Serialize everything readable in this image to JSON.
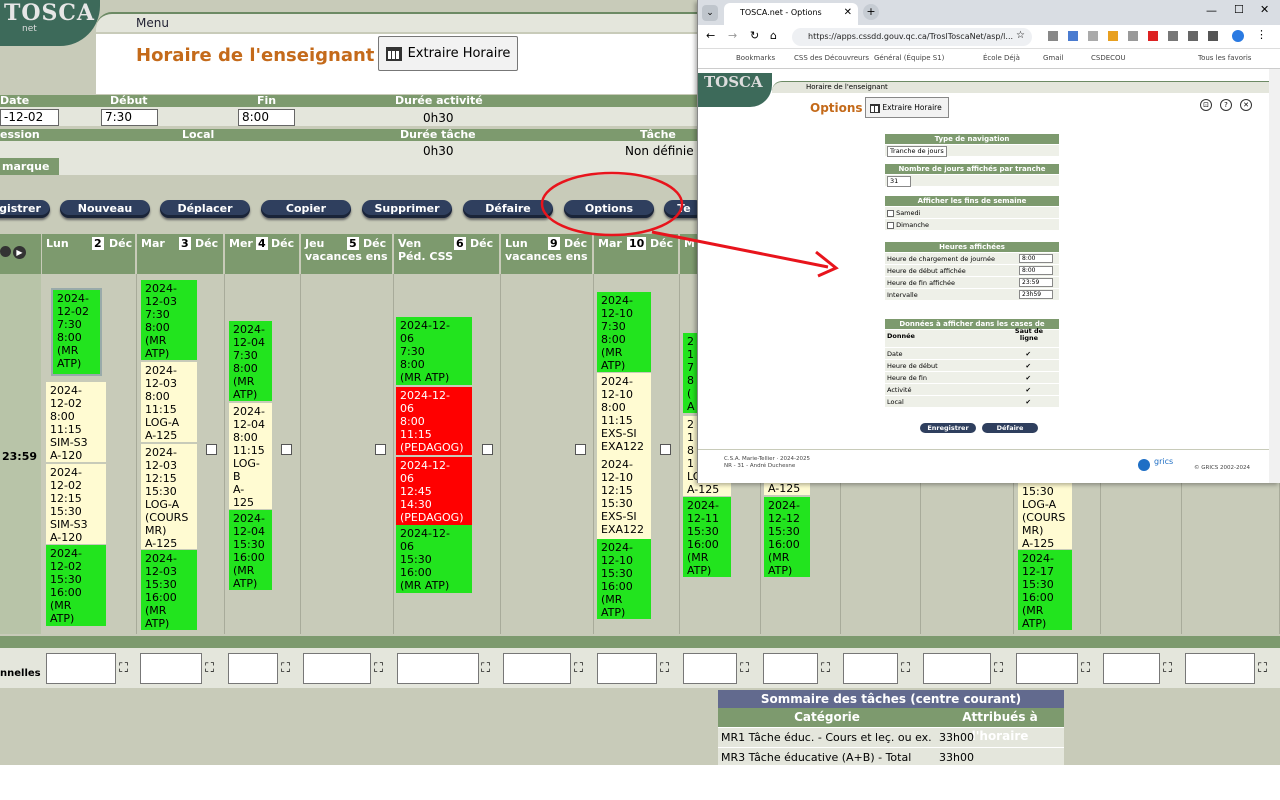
{
  "header": {
    "logo_text": "TOSCA",
    "logo_sub": "net",
    "menu_label": "Menu",
    "page_title": "Horaire de l'enseignant",
    "extract_label": "Extraire Horaire"
  },
  "form": {
    "date_label": "Date",
    "debut_label": "Début",
    "fin_label": "Fin",
    "duree_activite_label": "Durée activité",
    "date_value": "-12-02",
    "debut_value": "7:30",
    "fin_value": "8:00",
    "duree_activite_value": "0h30",
    "session_label": "ession",
    "local_label": "Local",
    "duree_tache_label": "Durée tâche",
    "tache_label": "Tâche",
    "duree_tache_value": "0h30",
    "tache_value": "Non définie",
    "remarque_label": "marque"
  },
  "actions": [
    "gistrer",
    "Nouveau",
    "Déplacer",
    "Copier",
    "Supprimer",
    "Défaire",
    "Options",
    "Te"
  ],
  "days": [
    {
      "name": "Lun",
      "num": "2",
      "month": "Déc",
      "sub": ""
    },
    {
      "name": "Mar",
      "num": "3",
      "month": "Déc",
      "sub": ""
    },
    {
      "name": "Mer",
      "num": "4",
      "month": "Déc",
      "sub": ""
    },
    {
      "name": "Jeu",
      "num": "5",
      "month": "Déc",
      "sub": "vacances ens"
    },
    {
      "name": "Ven",
      "num": "6",
      "month": "Déc",
      "sub": "Péd. CSS"
    },
    {
      "name": "Lun",
      "num": "9",
      "month": "Déc",
      "sub": "vacances ens"
    },
    {
      "name": "Mar",
      "num": "10",
      "month": "Déc",
      "sub": ""
    },
    {
      "name": "M",
      "num": "",
      "month": "",
      "sub": ""
    }
  ],
  "time_label": "23:59",
  "events": {
    "e1": "2024-\n12-02\n7:30\n8:00\n(MR\nATP)",
    "e2": "2024-\n12-02\n8:00\n11:15\nSIM-S3\nA-120",
    "e3": "2024-\n12-02\n12:15\n15:30\nSIM-S3\nA-120",
    "e4": "2024-\n12-02\n15:30\n16:00\n(MR\nATP)",
    "e5": "2024-\n12-03\n7:30\n8:00\n(MR\nATP)",
    "e6": "2024-\n12-03\n8:00\n11:15\nLOG-A\nA-125",
    "e7": "2024-\n12-03\n12:15\n15:30\nLOG-A\n(COURS\nMR)\nA-125",
    "e8": "2024-\n12-03\n15:30\n16:00\n(MR\nATP)",
    "e9": "2024-\n12-04\n7:30\n8:00\n(MR\nATP)",
    "e10": "2024-\n12-04\n8:00\n11:15\nLOG-\nB\nA-\n125",
    "e11": "2024-\n12-04\n15:30\n16:00\n(MR\nATP)",
    "e12": "2024-12-\n06\n7:30\n8:00\n(MR ATP)",
    "e13": "2024-12-\n06\n8:00\n11:15\n(PEDAGOG)",
    "e14": "2024-12-\n06\n12:45\n14:30\n(PEDAGOG)",
    "e15": "2024-12-\n06\n15:30\n16:00\n(MR ATP)",
    "e16": "2024-\n12-10\n7:30\n8:00\n(MR\nATP)",
    "e17": "2024-\n12-10\n8:00\n11:15\nEXS-SI\nEXA122",
    "e18": "2024-\n12-10\n12:15\n15:30\nEXS-SI\nEXA122",
    "e19": "2024-\n12-10\n15:30\n16:00\n(MR\nATP)",
    "e20": "2\n1\n7\n8\n(\nA",
    "e21": "2\n1\n8\n1\nLO\nA-125",
    "e22": "2024-\n12-11\n15:30\n16:00\n(MR\nATP)",
    "e23": "A-125",
    "e24": "2024-\n12-12\n15:30\n16:00\n(MR\nATP)",
    "e25": "15:30\nLOG-A\n(COURS\nMR)\nA-125",
    "e26": "2024-\n12-17\n15:30\n16:00\n(MR\nATP)"
  },
  "footer_label": "nnelles",
  "summary": {
    "title": "Sommaire des tâches (centre courant)",
    "col1": "Catégorie",
    "col2": "Attribués à l'horaire",
    "rows": [
      {
        "cat": "MR1 Tâche éduc. - Cours et leç. ou ex.",
        "val": "33h00"
      },
      {
        "cat": "MR3 Tâche éducative (A+B) - Total",
        "val": "33h00"
      }
    ]
  },
  "popup": {
    "tab_title": "TOSCA.net - Options",
    "url": "https://apps.cssdd.gouv.qc.ca/TroslToscaNet/asp/l...",
    "bookmarks": [
      "Bookmarks",
      "CSS des Découvreurs",
      "Général (Équipe S1)",
      "École Déjà",
      "Gmail",
      "CSDECOU",
      "Tous les favoris"
    ],
    "breadcrumb": "Horaire de l'enseignant",
    "options_title": "Options",
    "extract_label": "Extraire Horaire",
    "nav_type_h": "Type de navigation",
    "nav_type_v": "Tranche de jours",
    "days_h": "Nombre de jours affichés par tranche",
    "days_v": "31",
    "weekend_h": "Afficher les fins de semaine",
    "samedi": "Samedi",
    "dimanche": "Dimanche",
    "hours_h": "Heures affichées",
    "h1": "Heure de chargement de journée",
    "h1v": "8:00",
    "h2": "Heure de début affichée",
    "h2v": "8:00",
    "h3": "Heure de fin affichée",
    "h3v": "23:59",
    "h4": "Intervalle",
    "h4v": "23h59",
    "data_h": "Données à afficher dans les cases de l'horaire",
    "data_col": "Donnée",
    "data_col2": "Saut de ligne",
    "items": [
      "Date",
      "Heure de début",
      "Heure de fin",
      "Activité",
      "Local"
    ],
    "check": "✔",
    "save": "Enregistrer",
    "undo": "Défaire",
    "foot1": "C.S.A. Marie-Tellier · 2024-2025",
    "foot2": "NR - 31 - André Duchesne",
    "grics": "grics",
    "copy": "© GRICS 2002-2024"
  },
  "colors": {
    "accent_green": "#7d9a6e",
    "event_green": "#22e41e",
    "event_red": "#ff0000",
    "event_yellow": "#fffbd2",
    "title_orange": "#c46a1a",
    "annotation_red": "#e8141c"
  }
}
